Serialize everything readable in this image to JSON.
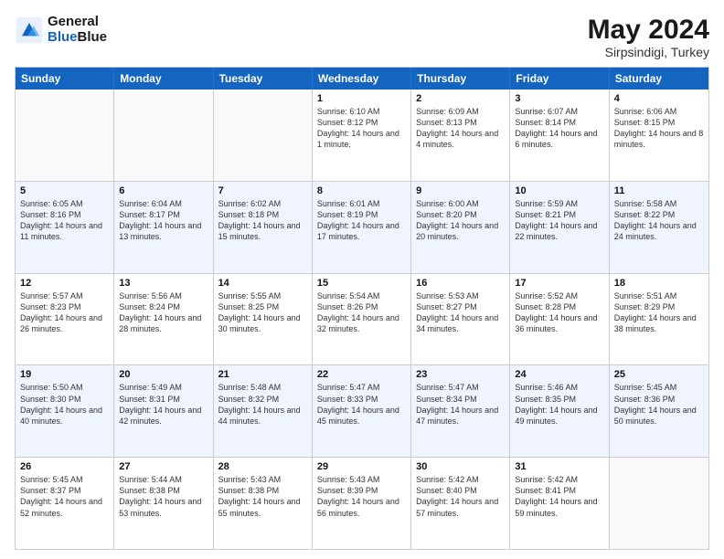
{
  "header": {
    "logo_general": "General",
    "logo_blue": "Blue",
    "month": "May 2024",
    "location": "Sirpsindigi, Turkey"
  },
  "weekdays": [
    "Sunday",
    "Monday",
    "Tuesday",
    "Wednesday",
    "Thursday",
    "Friday",
    "Saturday"
  ],
  "rows": [
    {
      "alt": false,
      "cells": [
        {
          "day": "",
          "info": ""
        },
        {
          "day": "",
          "info": ""
        },
        {
          "day": "",
          "info": ""
        },
        {
          "day": "1",
          "info": "Sunrise: 6:10 AM\nSunset: 8:12 PM\nDaylight: 14 hours\nand 1 minute."
        },
        {
          "day": "2",
          "info": "Sunrise: 6:09 AM\nSunset: 8:13 PM\nDaylight: 14 hours\nand 4 minutes."
        },
        {
          "day": "3",
          "info": "Sunrise: 6:07 AM\nSunset: 8:14 PM\nDaylight: 14 hours\nand 6 minutes."
        },
        {
          "day": "4",
          "info": "Sunrise: 6:06 AM\nSunset: 8:15 PM\nDaylight: 14 hours\nand 8 minutes."
        }
      ]
    },
    {
      "alt": true,
      "cells": [
        {
          "day": "5",
          "info": "Sunrise: 6:05 AM\nSunset: 8:16 PM\nDaylight: 14 hours\nand 11 minutes."
        },
        {
          "day": "6",
          "info": "Sunrise: 6:04 AM\nSunset: 8:17 PM\nDaylight: 14 hours\nand 13 minutes."
        },
        {
          "day": "7",
          "info": "Sunrise: 6:02 AM\nSunset: 8:18 PM\nDaylight: 14 hours\nand 15 minutes."
        },
        {
          "day": "8",
          "info": "Sunrise: 6:01 AM\nSunset: 8:19 PM\nDaylight: 14 hours\nand 17 minutes."
        },
        {
          "day": "9",
          "info": "Sunrise: 6:00 AM\nSunset: 8:20 PM\nDaylight: 14 hours\nand 20 minutes."
        },
        {
          "day": "10",
          "info": "Sunrise: 5:59 AM\nSunset: 8:21 PM\nDaylight: 14 hours\nand 22 minutes."
        },
        {
          "day": "11",
          "info": "Sunrise: 5:58 AM\nSunset: 8:22 PM\nDaylight: 14 hours\nand 24 minutes."
        }
      ]
    },
    {
      "alt": false,
      "cells": [
        {
          "day": "12",
          "info": "Sunrise: 5:57 AM\nSunset: 8:23 PM\nDaylight: 14 hours\nand 26 minutes."
        },
        {
          "day": "13",
          "info": "Sunrise: 5:56 AM\nSunset: 8:24 PM\nDaylight: 14 hours\nand 28 minutes."
        },
        {
          "day": "14",
          "info": "Sunrise: 5:55 AM\nSunset: 8:25 PM\nDaylight: 14 hours\nand 30 minutes."
        },
        {
          "day": "15",
          "info": "Sunrise: 5:54 AM\nSunset: 8:26 PM\nDaylight: 14 hours\nand 32 minutes."
        },
        {
          "day": "16",
          "info": "Sunrise: 5:53 AM\nSunset: 8:27 PM\nDaylight: 14 hours\nand 34 minutes."
        },
        {
          "day": "17",
          "info": "Sunrise: 5:52 AM\nSunset: 8:28 PM\nDaylight: 14 hours\nand 36 minutes."
        },
        {
          "day": "18",
          "info": "Sunrise: 5:51 AM\nSunset: 8:29 PM\nDaylight: 14 hours\nand 38 minutes."
        }
      ]
    },
    {
      "alt": true,
      "cells": [
        {
          "day": "19",
          "info": "Sunrise: 5:50 AM\nSunset: 8:30 PM\nDaylight: 14 hours\nand 40 minutes."
        },
        {
          "day": "20",
          "info": "Sunrise: 5:49 AM\nSunset: 8:31 PM\nDaylight: 14 hours\nand 42 minutes."
        },
        {
          "day": "21",
          "info": "Sunrise: 5:48 AM\nSunset: 8:32 PM\nDaylight: 14 hours\nand 44 minutes."
        },
        {
          "day": "22",
          "info": "Sunrise: 5:47 AM\nSunset: 8:33 PM\nDaylight: 14 hours\nand 45 minutes."
        },
        {
          "day": "23",
          "info": "Sunrise: 5:47 AM\nSunset: 8:34 PM\nDaylight: 14 hours\nand 47 minutes."
        },
        {
          "day": "24",
          "info": "Sunrise: 5:46 AM\nSunset: 8:35 PM\nDaylight: 14 hours\nand 49 minutes."
        },
        {
          "day": "25",
          "info": "Sunrise: 5:45 AM\nSunset: 8:36 PM\nDaylight: 14 hours\nand 50 minutes."
        }
      ]
    },
    {
      "alt": false,
      "cells": [
        {
          "day": "26",
          "info": "Sunrise: 5:45 AM\nSunset: 8:37 PM\nDaylight: 14 hours\nand 52 minutes."
        },
        {
          "day": "27",
          "info": "Sunrise: 5:44 AM\nSunset: 8:38 PM\nDaylight: 14 hours\nand 53 minutes."
        },
        {
          "day": "28",
          "info": "Sunrise: 5:43 AM\nSunset: 8:38 PM\nDaylight: 14 hours\nand 55 minutes."
        },
        {
          "day": "29",
          "info": "Sunrise: 5:43 AM\nSunset: 8:39 PM\nDaylight: 14 hours\nand 56 minutes."
        },
        {
          "day": "30",
          "info": "Sunrise: 5:42 AM\nSunset: 8:40 PM\nDaylight: 14 hours\nand 57 minutes."
        },
        {
          "day": "31",
          "info": "Sunrise: 5:42 AM\nSunset: 8:41 PM\nDaylight: 14 hours\nand 59 minutes."
        },
        {
          "day": "",
          "info": ""
        }
      ]
    }
  ]
}
